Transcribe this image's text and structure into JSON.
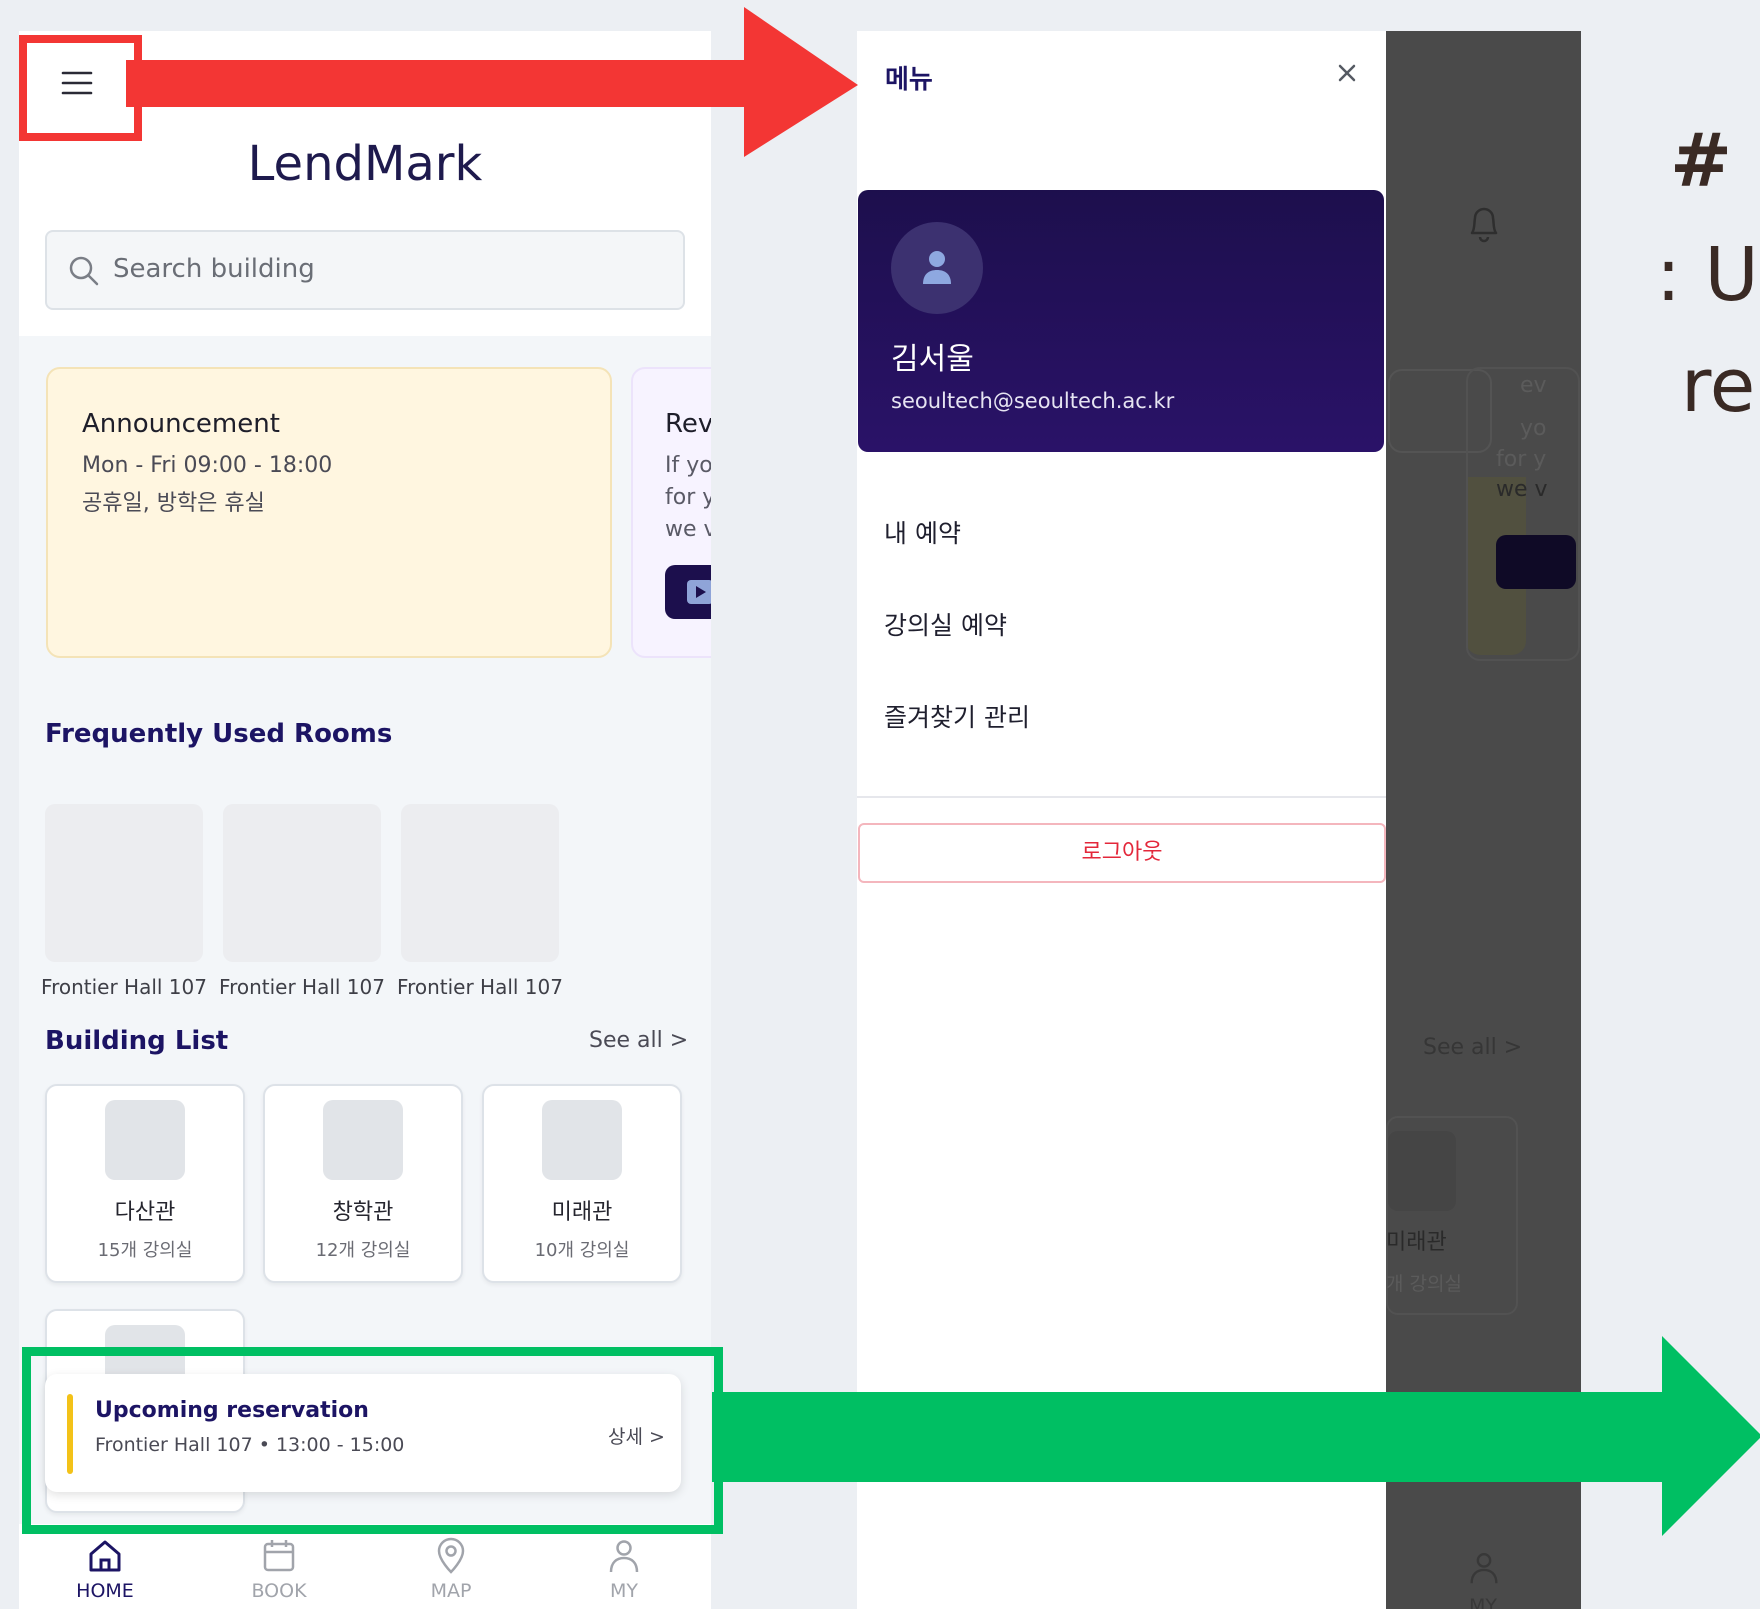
{
  "left_screen": {
    "app_title": "LendMark",
    "search": {
      "placeholder": "Search building"
    },
    "announcement": {
      "title": "Announcement",
      "line1": "Mon - Fri 09:00 - 18:00",
      "line2": "공휴일, 방학은 휴실"
    },
    "review_card": {
      "title": "Rev",
      "line1": "If yo",
      "line2": "for y",
      "line3": "we v"
    },
    "frequent_rooms": {
      "title": "Frequently Used Rooms",
      "items": [
        {
          "label": "Frontier Hall 107"
        },
        {
          "label": "Frontier Hall 107"
        },
        {
          "label": "Frontier Hall 107"
        }
      ]
    },
    "building_list": {
      "title": "Building List",
      "see_all": "See all >",
      "items": [
        {
          "name": "다산관",
          "count": "15개 강의실"
        },
        {
          "name": "창학관",
          "count": "12개 강의실"
        },
        {
          "name": "미래관",
          "count": "10개 강의실"
        }
      ]
    },
    "upcoming": {
      "title": "Upcoming reservation",
      "details": "Frontier Hall 107 • 13:00 - 15:00",
      "link": "상세 >"
    },
    "tabs": [
      {
        "label": "HOME",
        "icon": "home-icon",
        "active": true
      },
      {
        "label": "BOOK",
        "icon": "calendar-icon",
        "active": false
      },
      {
        "label": "MAP",
        "icon": "map-pin-icon",
        "active": false
      },
      {
        "label": "MY",
        "icon": "user-icon",
        "active": false
      }
    ]
  },
  "drawer": {
    "title": "메뉴",
    "profile": {
      "name": "김서울",
      "email": "seoultech@seoultech.ac.kr"
    },
    "menu_items": [
      {
        "label": "내 예약"
      },
      {
        "label": "강의실 예약"
      },
      {
        "label": "즐겨찾기 관리"
      }
    ],
    "logout_label": "로그아웃"
  },
  "background_screen": {
    "review_text": [
      "ev",
      "yo",
      "for y",
      "we v"
    ],
    "see_all": "See all >",
    "building_name": "미래관",
    "building_count": "개 강의실",
    "tab_label": "MY"
  },
  "annotation": {
    "heading": "# U",
    "line1": ": Us",
    "line2": "re"
  },
  "colors": {
    "brand_navy": "#1c1464",
    "highlight_red": "#f33634",
    "highlight_green": "#00bf63",
    "logout_red": "#e3273a",
    "accent_yellow": "#f3c218"
  }
}
